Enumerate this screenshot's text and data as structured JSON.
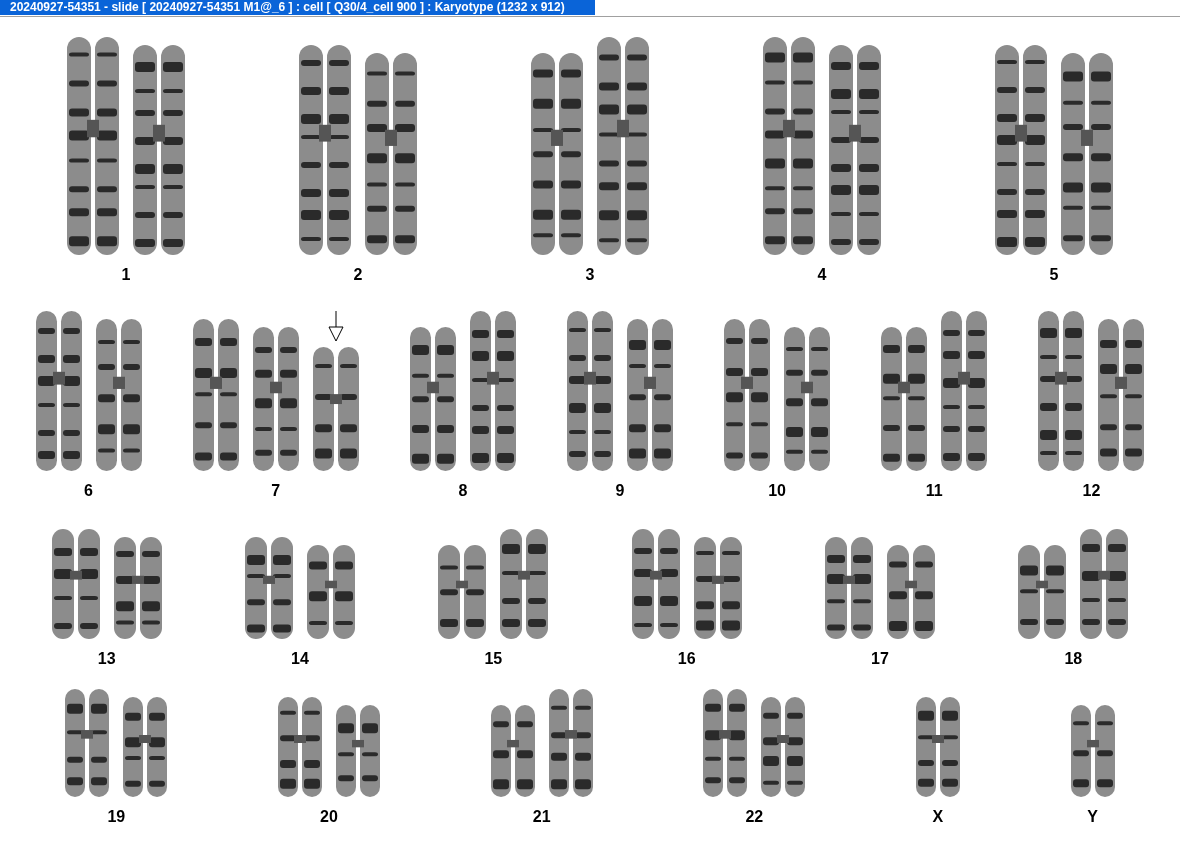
{
  "window": {
    "title": "20240927-54351 - slide [ 20240927-54351 M1@_6 ] : cell [ Q30/4_cell 900 ] : Karyotype  (1232 x 912)"
  },
  "rows": [
    {
      "groups": [
        {
          "label": "1",
          "chromosomes": [
            {
              "kind": "chromosome",
              "marked": false
            },
            {
              "kind": "chromosome",
              "marked": false
            }
          ]
        },
        {
          "label": "2",
          "chromosomes": [
            {
              "kind": "chromosome",
              "marked": false
            },
            {
              "kind": "chromosome",
              "marked": false
            }
          ]
        },
        {
          "label": "3",
          "chromosomes": [
            {
              "kind": "chromosome",
              "marked": false
            },
            {
              "kind": "chromosome",
              "marked": false
            }
          ]
        },
        {
          "label": "4",
          "chromosomes": [
            {
              "kind": "chromosome",
              "marked": false
            },
            {
              "kind": "chromosome",
              "marked": false
            }
          ]
        },
        {
          "label": "5",
          "chromosomes": [
            {
              "kind": "chromosome",
              "marked": false
            },
            {
              "kind": "chromosome",
              "marked": false
            }
          ]
        }
      ]
    },
    {
      "groups": [
        {
          "label": "6",
          "chromosomes": [
            {
              "kind": "chromosome",
              "marked": false
            },
            {
              "kind": "chromosome",
              "marked": false
            }
          ]
        },
        {
          "label": "7",
          "chromosomes": [
            {
              "kind": "chromosome",
              "marked": false
            },
            {
              "kind": "chromosome",
              "marked": false
            },
            {
              "kind": "chromosome",
              "marked": true
            }
          ]
        },
        {
          "label": "8",
          "chromosomes": [
            {
              "kind": "chromosome",
              "marked": false
            },
            {
              "kind": "chromosome",
              "marked": false
            }
          ]
        },
        {
          "label": "9",
          "chromosomes": [
            {
              "kind": "chromosome",
              "marked": false
            },
            {
              "kind": "chromosome",
              "marked": false
            }
          ]
        },
        {
          "label": "10",
          "chromosomes": [
            {
              "kind": "chromosome",
              "marked": false
            },
            {
              "kind": "chromosome",
              "marked": false
            }
          ]
        },
        {
          "label": "11",
          "chromosomes": [
            {
              "kind": "chromosome",
              "marked": false
            },
            {
              "kind": "chromosome",
              "marked": false
            }
          ]
        },
        {
          "label": "12",
          "chromosomes": [
            {
              "kind": "chromosome",
              "marked": false
            },
            {
              "kind": "chromosome",
              "marked": false
            }
          ]
        }
      ]
    },
    {
      "groups": [
        {
          "label": "13",
          "chromosomes": [
            {
              "kind": "chromosome",
              "marked": false
            },
            {
              "kind": "chromosome",
              "marked": false
            }
          ]
        },
        {
          "label": "14",
          "chromosomes": [
            {
              "kind": "chromosome",
              "marked": false
            },
            {
              "kind": "chromosome",
              "marked": false
            }
          ]
        },
        {
          "label": "15",
          "chromosomes": [
            {
              "kind": "chromosome",
              "marked": false
            },
            {
              "kind": "chromosome",
              "marked": false
            }
          ]
        },
        {
          "label": "16",
          "chromosomes": [
            {
              "kind": "chromosome",
              "marked": false
            },
            {
              "kind": "chromosome",
              "marked": false
            }
          ]
        },
        {
          "label": "17",
          "chromosomes": [
            {
              "kind": "chromosome",
              "marked": false
            },
            {
              "kind": "chromosome",
              "marked": false
            }
          ]
        },
        {
          "label": "18",
          "chromosomes": [
            {
              "kind": "chromosome",
              "marked": false
            },
            {
              "kind": "chromosome",
              "marked": false
            }
          ]
        }
      ]
    },
    {
      "groups": [
        {
          "label": "19",
          "chromosomes": [
            {
              "kind": "chromosome",
              "marked": false
            },
            {
              "kind": "chromosome",
              "marked": false
            }
          ]
        },
        {
          "label": "20",
          "chromosomes": [
            {
              "kind": "chromosome",
              "marked": false
            },
            {
              "kind": "chromosome",
              "marked": false
            }
          ]
        },
        {
          "label": "21",
          "chromosomes": [
            {
              "kind": "chromosome",
              "marked": false
            },
            {
              "kind": "chromosome",
              "marked": false
            }
          ]
        },
        {
          "label": "22",
          "chromosomes": [
            {
              "kind": "chromosome",
              "marked": false
            },
            {
              "kind": "chromosome",
              "marked": false
            }
          ]
        },
        {
          "label": "X",
          "chromosomes": [
            {
              "kind": "chromosome",
              "marked": false
            }
          ]
        },
        {
          "label": "Y",
          "chromosomes": [
            {
              "kind": "chromosome",
              "marked": false
            }
          ]
        }
      ]
    }
  ]
}
